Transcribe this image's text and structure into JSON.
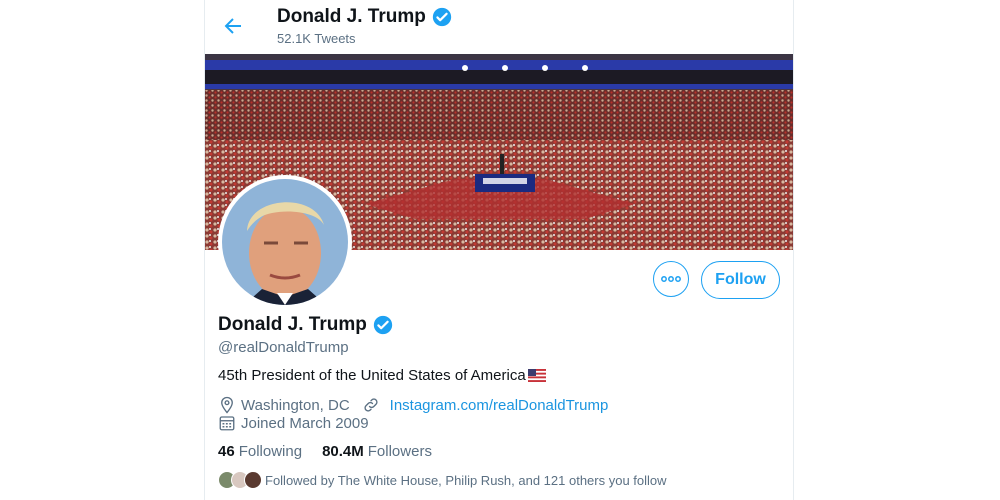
{
  "header": {
    "title": "Donald J. Trump",
    "tweet_count": "52.1K Tweets"
  },
  "profile": {
    "name": "Donald J. Trump",
    "handle": "@realDonaldTrump",
    "bio": "45th President of the United States of America",
    "location": "Washington, DC",
    "website": "Instagram.com/realDonaldTrump",
    "joined": "Joined March 2009",
    "following_count": "46",
    "following_label": "Following",
    "followers_count": "80.4M",
    "followers_label": "Followers",
    "followed_by": "Followed by The White House, Philip Rush, and 121 others you follow"
  },
  "actions": {
    "follow_label": "Follow",
    "more_icon": "more-horizontal-icon"
  },
  "colors": {
    "accent": "#1da1f2",
    "link": "#1b95e0",
    "secondary_text": "#5b7083"
  }
}
